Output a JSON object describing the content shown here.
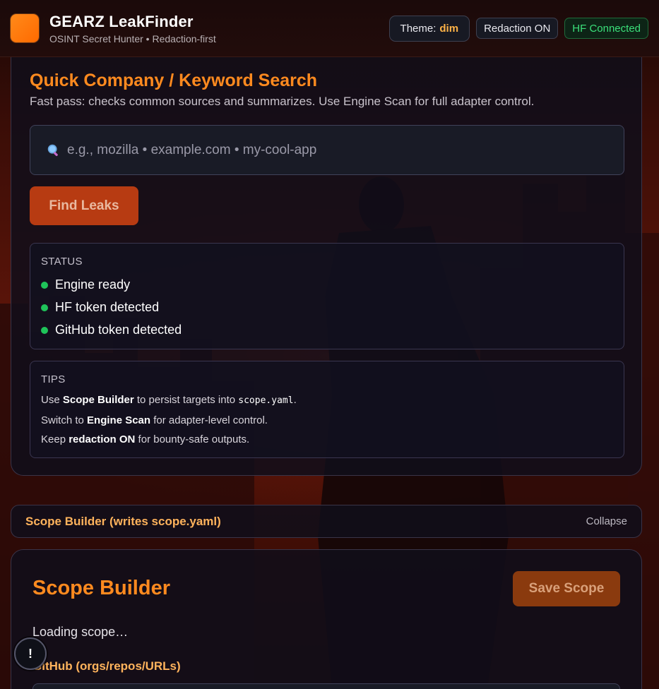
{
  "header": {
    "title": "GEARZ LeakFinder",
    "subtitle": "OSINT Secret Hunter • Redaction-first",
    "theme_label": "Theme:",
    "theme_value": "dim",
    "redaction_badge": "Redaction ON",
    "hf_badge": "HF Connected"
  },
  "quick_search": {
    "title": "Quick Company / Keyword Search",
    "description": "Fast pass: checks common sources and summarizes. Use Engine Scan for full adapter control.",
    "search_placeholder": "e.g., mozilla • example.com • my-cool-app",
    "search_value": "",
    "search_icon": "magnifier-icon",
    "find_button": "Find Leaks"
  },
  "status": {
    "label": "STATUS",
    "items": [
      "Engine ready",
      "HF token detected",
      "GitHub token detected"
    ],
    "indicator_color": "#1fc45a"
  },
  "tips": {
    "label": "TIPS",
    "tip1": {
      "pre": "Use ",
      "bold": "Scope Builder",
      "mid": " to persist targets into ",
      "code": "scope.yaml",
      "post": "."
    },
    "tip2": {
      "pre": "Switch to ",
      "bold": "Engine Scan",
      "post": " for adapter-level control."
    },
    "tip3": {
      "pre": "Keep ",
      "bold": "redaction ON",
      "post": " for bounty-safe outputs."
    }
  },
  "scope_section": {
    "toggle_title": "Scope Builder (writes scope.yaml)",
    "collapse_label": "Collapse",
    "title": "Scope Builder",
    "save_button": "Save Scope",
    "loading_text": "Loading scope…",
    "github_label": "GitHub (orgs/repos/URLs)"
  },
  "floating_button": {
    "glyph": "!"
  },
  "colors": {
    "accent": "#ff8a1f",
    "brand_logo": "#ff7a0a",
    "hf_connected": "#3be07a"
  }
}
